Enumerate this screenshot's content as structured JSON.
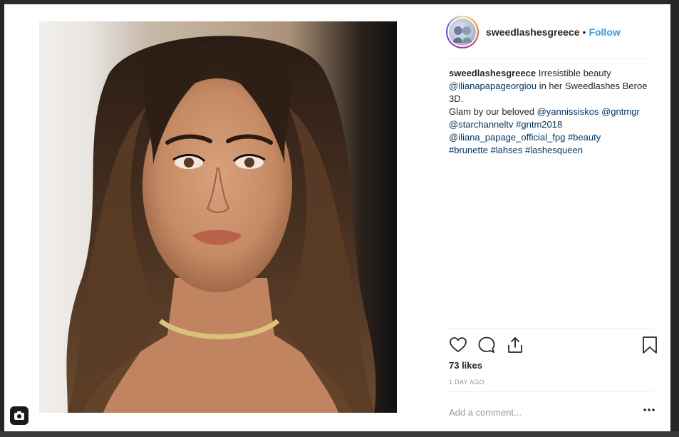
{
  "post": {
    "username": "sweedlashesgreece",
    "separator": "•",
    "follow_label": "Follow",
    "caption": {
      "user": "sweedlashesgreece",
      "text1": " Irresistible beauty ",
      "mention1": "@ilianapapageorgiou",
      "text2": " in her Sweedlashes Beroe 3D.",
      "text3": "Glam by our beloved ",
      "mention2": "@yannissiskos",
      "mention3": "@gntmgr",
      "mention4": "@starchanneltv",
      "tag1": "#gntm2018",
      "mention5": "@iliana_papage_official_fpg",
      "tag2": "#beauty",
      "tag3": "#brunette",
      "tag4": "#lahses",
      "tag5": "#lashesqueen"
    },
    "likes": "73 likes",
    "timestamp": "1 DAY AGO",
    "comment_placeholder": "Add a comment...",
    "more_label": "•••"
  },
  "icons": {
    "like": "heart-icon",
    "comment": "comment-icon",
    "share": "share-icon",
    "save": "bookmark-icon",
    "camera": "camera-icon"
  },
  "colors": {
    "follow": "#3897f0",
    "link": "#003569",
    "muted": "#999999",
    "text": "#262626"
  }
}
